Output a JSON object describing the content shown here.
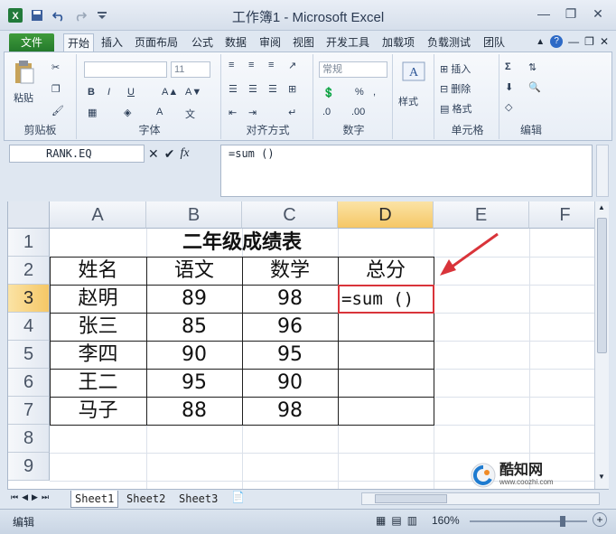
{
  "window": {
    "title": "工作簿1 - Microsoft Excel",
    "app_icon_label": "X"
  },
  "tabs": [
    "文件",
    "开始",
    "插入",
    "页面布局",
    "公式",
    "数据",
    "审阅",
    "视图",
    "开发工具",
    "加载项",
    "负载测试",
    "团队"
  ],
  "ribbon": {
    "groups": {
      "clipboard": "剪贴板",
      "font": "字体",
      "alignment": "对齐方式",
      "number": "数字",
      "styles": "样式",
      "cells": "单元格",
      "editing": "编辑"
    },
    "paste": "粘贴",
    "font_size": "11",
    "number_format": "常规",
    "bold": "B",
    "italic": "I",
    "underline": "U",
    "cells_insert": "插入",
    "cells_delete": "删除",
    "cells_format": "格式",
    "percent": "%"
  },
  "formula_bar": {
    "name_box": "RANK.EQ",
    "fx": "fx",
    "formula": "=sum ()"
  },
  "columns": [
    "A",
    "B",
    "C",
    "D",
    "E",
    "F"
  ],
  "rows": [
    "1",
    "2",
    "3",
    "4",
    "5",
    "6",
    "7",
    "8",
    "9"
  ],
  "sheet": {
    "title": "二年级成绩表",
    "headers": [
      "姓名",
      "语文",
      "数学",
      "总分"
    ],
    "data": [
      [
        "赵明",
        "89",
        "98"
      ],
      [
        "张三",
        "85",
        "96"
      ],
      [
        "李四",
        "90",
        "95"
      ],
      [
        "王二",
        "95",
        "90"
      ],
      [
        "马子",
        "88",
        "98"
      ]
    ],
    "editing_cell": "=sum ()"
  },
  "sheet_tabs": [
    "Sheet1",
    "Sheet2",
    "Sheet3"
  ],
  "status": {
    "mode": "编辑",
    "zoom": "160%"
  },
  "watermark": {
    "brand": "酷知网",
    "url": "www.coozhi.com"
  },
  "colors": {
    "accent_green": "#23782b",
    "selected_header": "#f5c766",
    "annotation_red": "#d9343a"
  }
}
